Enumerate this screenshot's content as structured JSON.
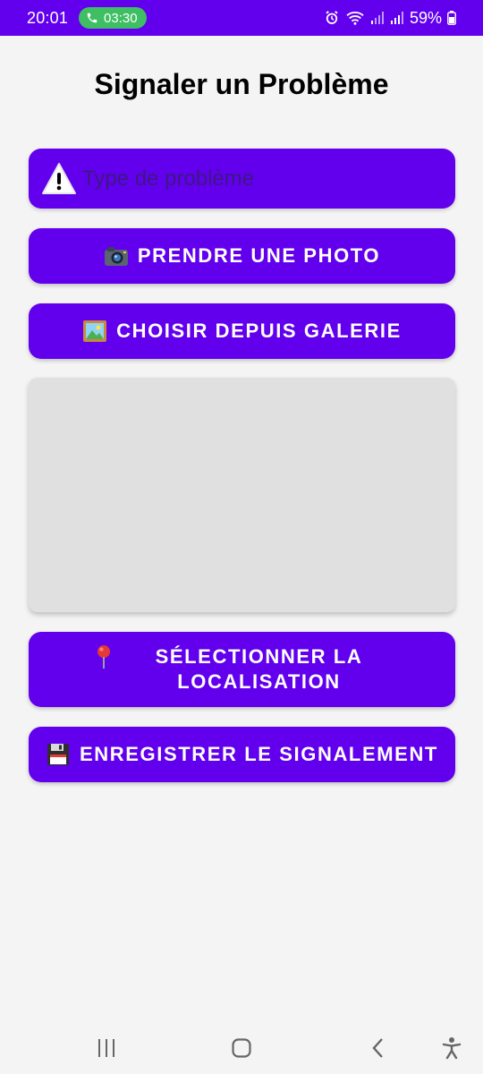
{
  "status_bar": {
    "time": "20:01",
    "call_duration": "03:30",
    "battery": "59%",
    "icons": [
      "phone-icon",
      "alarm-icon",
      "wifi-icon",
      "signal-icon",
      "battery-icon"
    ]
  },
  "page": {
    "title": "Signaler un Problème"
  },
  "problem_type": {
    "placeholder": "Type de problème",
    "value": "",
    "icon": "warning-icon"
  },
  "buttons": {
    "take_photo": {
      "label": "PRENDRE UNE PHOTO",
      "icon": "camera-icon"
    },
    "choose_gallery": {
      "label": "CHOISIR DEPUIS GALERIE",
      "icon": "picture-icon"
    },
    "select_location": {
      "label": "SÉLECTIONNER LA LOCALISATION",
      "icon": "pin-icon"
    },
    "save_report": {
      "label": "ENREGISTRER LE SIGNALEMENT",
      "icon": "floppy-disk-icon"
    }
  },
  "nav_bar": {
    "icons": [
      "recent-apps-icon",
      "home-icon",
      "back-icon",
      "accessibility-icon"
    ]
  },
  "colors": {
    "accent": "#6200ee",
    "background": "#f4f4f4",
    "preview_placeholder": "#e0e0e0",
    "call_pill": "#3fbf63"
  }
}
